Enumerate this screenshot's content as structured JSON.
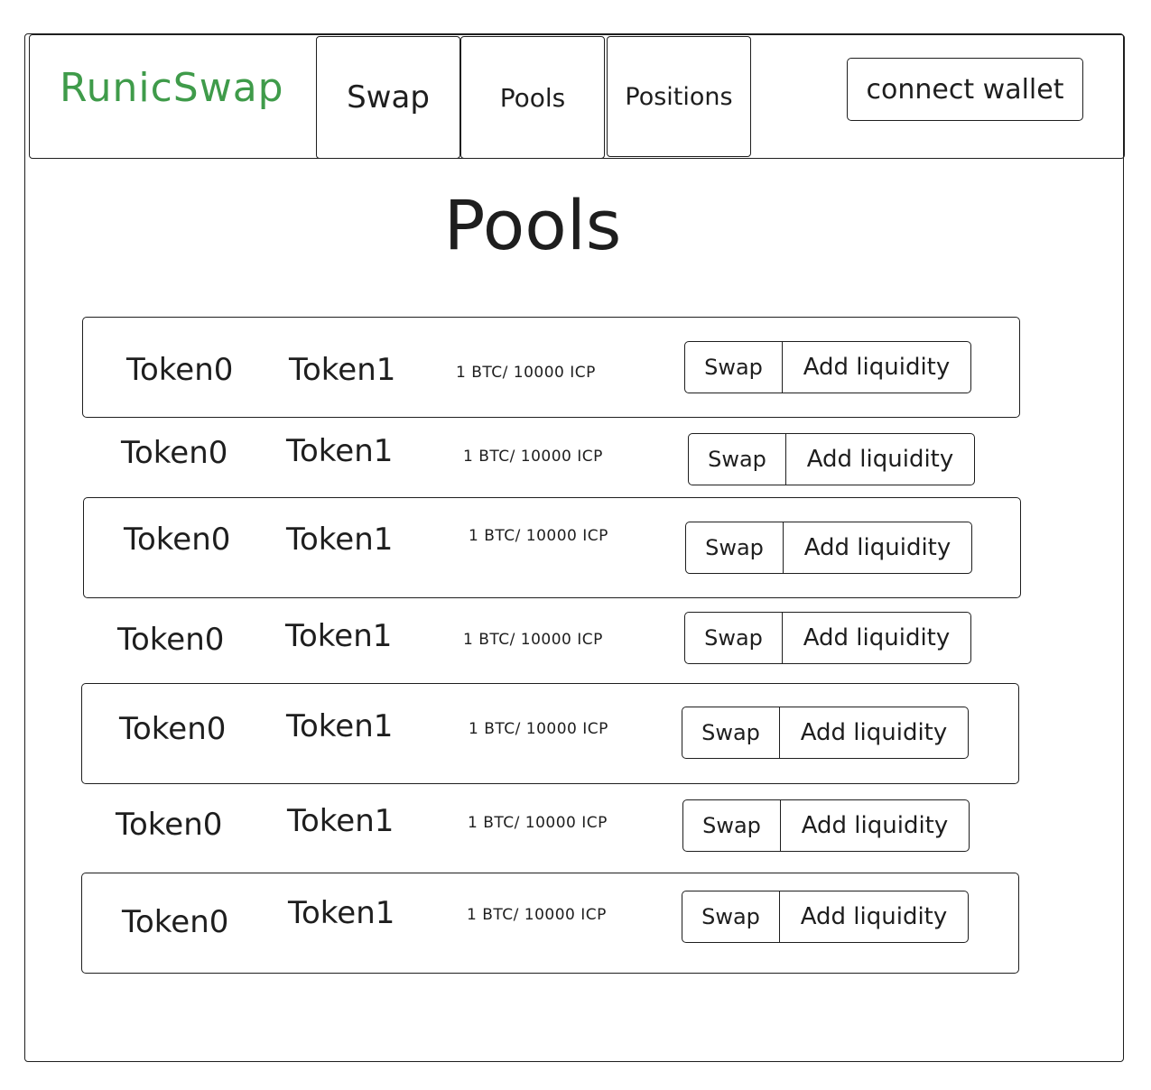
{
  "header": {
    "logo": "RunicSwap",
    "nav": [
      "Swap",
      "Pools",
      "Positions"
    ],
    "connect_label": "connect wallet",
    "logo_color": "#3f9b4a"
  },
  "page": {
    "title": "Pools"
  },
  "pools": [
    {
      "token0": "Token0",
      "token1": "Token1",
      "rate": "1 BTC/ 10000 ICP",
      "swap_label": "Swap",
      "add_label": "Add liquidity"
    },
    {
      "token0": "Token0",
      "token1": "Token1",
      "rate": "1 BTC/ 10000 ICP",
      "swap_label": "Swap",
      "add_label": "Add liquidity"
    },
    {
      "token0": "Token0",
      "token1": "Token1",
      "rate": "1 BTC/ 10000 ICP",
      "swap_label": "Swap",
      "add_label": "Add liquidity"
    },
    {
      "token0": "Token0",
      "token1": "Token1",
      "rate": "1 BTC/ 10000 ICP",
      "swap_label": "Swap",
      "add_label": "Add liquidity"
    },
    {
      "token0": "Token0",
      "token1": "Token1",
      "rate": "1 BTC/ 10000 ICP",
      "swap_label": "Swap",
      "add_label": "Add liquidity"
    },
    {
      "token0": "Token0",
      "token1": "Token1",
      "rate": "1 BTC/ 10000 ICP",
      "swap_label": "Swap",
      "add_label": "Add liquidity"
    },
    {
      "token0": "Token0",
      "token1": "Token1",
      "rate": "1 BTC/ 10000 ICP",
      "swap_label": "Swap",
      "add_label": "Add liquidity"
    }
  ]
}
